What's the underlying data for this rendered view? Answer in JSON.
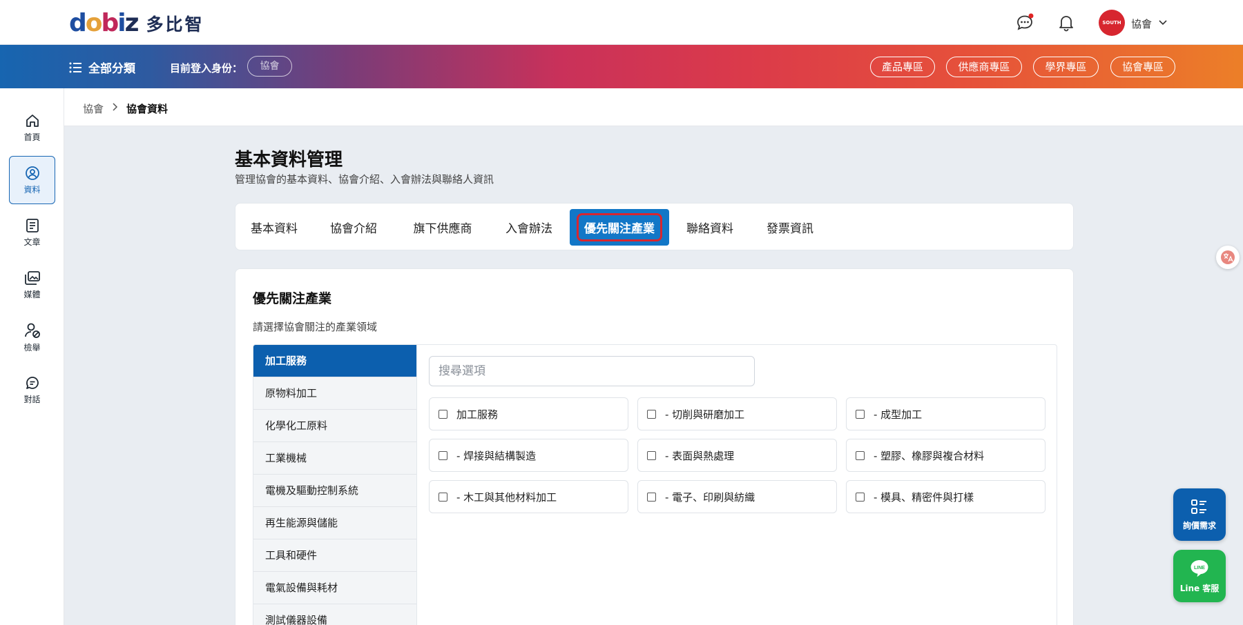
{
  "header": {
    "logo_mark": "dobiz",
    "logo_text": "多比智",
    "user_name": "協會",
    "avatar_text": "SOUTH"
  },
  "banner": {
    "category_label": "全部分類",
    "login_as_label": "目前登入身份：",
    "login_role": "協會",
    "zones": [
      "產品專區",
      "供應商專區",
      "學界專區",
      "協會專區"
    ]
  },
  "leftnav": {
    "items": [
      {
        "label": "首頁",
        "icon": "home-icon"
      },
      {
        "label": "資料",
        "icon": "user-circle-icon",
        "active": true
      },
      {
        "label": "文章",
        "icon": "document-icon"
      },
      {
        "label": "媒體",
        "icon": "media-icon"
      },
      {
        "label": "檢舉",
        "icon": "report-user-icon"
      },
      {
        "label": "對話",
        "icon": "chat-icon"
      }
    ]
  },
  "breadcrumb": {
    "parent": "協會",
    "current": "協會資料"
  },
  "page": {
    "title": "基本資料管理",
    "subtitle": "管理協會的基本資料、協會介紹、入會辦法與聯絡人資訊"
  },
  "tabs": [
    "基本資料",
    "協會介紹",
    "旗下供應商",
    "入會辦法",
    "優先關注產業",
    "聯絡資料",
    "發票資訊"
  ],
  "active_tab": "優先關注產業",
  "panel": {
    "title": "優先關注產業",
    "subtitle": "請選擇協會關注的產業領域",
    "categories": [
      "加工服務",
      "原物料加工",
      "化學化工原料",
      "工業機械",
      "電機及驅動控制系統",
      "再生能源與儲能",
      "工具和硬件",
      "電氣設備與耗材",
      "測試儀器設備"
    ],
    "search_placeholder": "搜尋選項",
    "options": [
      "加工服務",
      "- 切削與研磨加工",
      "- 成型加工",
      "- 焊接與結構製造",
      "- 表面與熱處理",
      "- 塑膠、橡膠與複合材料",
      "- 木工與其他材料加工",
      "- 電子、印刷與紡織",
      "- 模具、精密件與打樣"
    ]
  },
  "floating": {
    "quote_label": "詢價需求",
    "line_label": "Line 客服",
    "line_badge": "LINE"
  },
  "colors": {
    "primary": "#0c5fae",
    "accent_red": "#d8262f",
    "line_green": "#22b550"
  }
}
